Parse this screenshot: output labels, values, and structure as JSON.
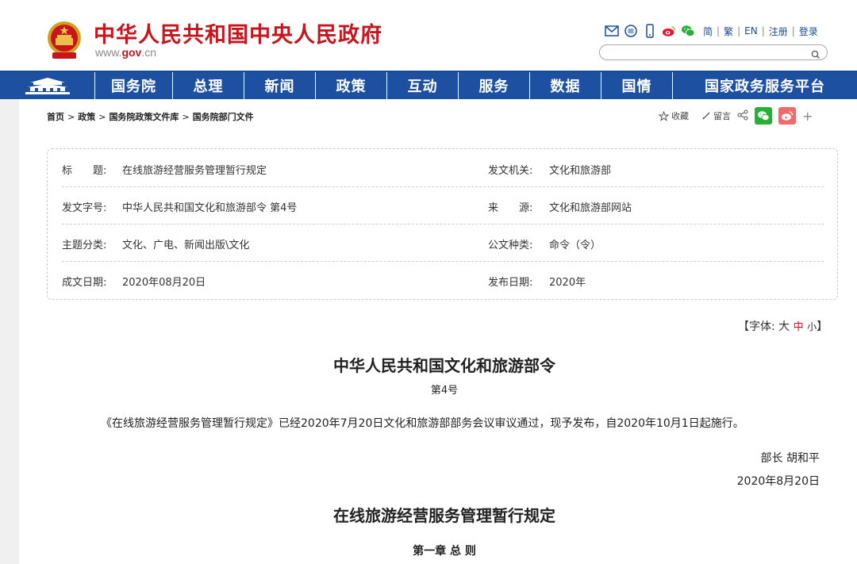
{
  "header": {
    "site_title": "中华人民共和国中央人民政府",
    "url_prefix": "www.",
    "url_brand": "gov",
    "url_suffix": ".cn",
    "lang_links": [
      "简",
      "繁",
      "EN",
      "注册",
      "登录"
    ],
    "search_placeholder": ""
  },
  "nav": {
    "items": [
      "国务院",
      "总理",
      "新闻",
      "政策",
      "互动",
      "服务",
      "数据",
      "国情",
      "国家政务服务平台"
    ]
  },
  "breadcrumb": [
    "首页",
    "政策",
    "国务院政策文件库",
    "国务院部门文件"
  ],
  "share": {
    "favorite": "收藏",
    "comment": "留言"
  },
  "info": {
    "title_label": "标题",
    "title_value": "在线旅游经营服务管理暂行规定",
    "issuer_label": "发文机关:",
    "issuer_value": "文化和旅游部",
    "doc_no_label": "发文字号:",
    "doc_no_value": "中华人民共和国文化和旅游部令 第4号",
    "source_label": "来源",
    "source_value": "文化和旅游部网站",
    "topic_label": "主题分类:",
    "topic_value": "文化、广电、新闻出版\\文化",
    "type_label": "公文种类:",
    "type_value": "命令（令）",
    "written_label": "成文日期:",
    "written_value": "2020年08月20日",
    "publish_label": "发布日期:",
    "publish_value": "2020年"
  },
  "font_size": {
    "prefix": "【字体:",
    "large": "大",
    "medium": "中",
    "small": "小",
    "suffix": "】"
  },
  "document": {
    "order_title": "中华人民共和国文化和旅游部令",
    "order_no": "第4号",
    "intro": "《在线旅游经营服务管理暂行规定》已经2020年7月20日文化和旅游部部务会议审议通过，现予发布，自2020年10月1日起施行。",
    "signer": "部长 胡和平",
    "sign_date": "2020年8月20日",
    "regulation_title": "在线旅游经营服务管理暂行规定",
    "chapter": "第一章 总 则"
  },
  "colors": {
    "brand_red": "#c8151d",
    "nav_blue": "#1e50a2"
  }
}
